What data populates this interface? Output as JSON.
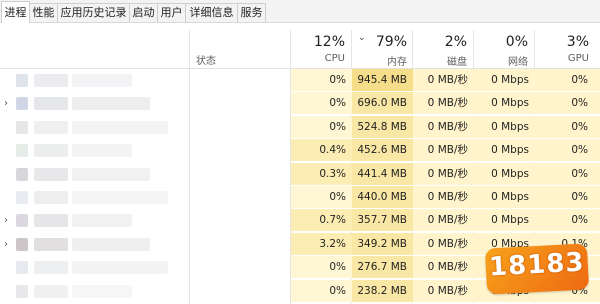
{
  "tabs": [
    "进程",
    "性能",
    "应用历史记录",
    "启动",
    "用户",
    "详细信息",
    "服务"
  ],
  "header": {
    "status_label": "状态",
    "columns": [
      {
        "pct": "12%",
        "label": "CPU"
      },
      {
        "pct": "79%",
        "label": "内存"
      },
      {
        "pct": "2%",
        "label": "磁盘"
      },
      {
        "pct": "0%",
        "label": "网络"
      },
      {
        "pct": "3%",
        "label": "GPU"
      }
    ],
    "sort_indicator": "⌄"
  },
  "rows": [
    {
      "cpu": "0%",
      "mem": "945.4 MB",
      "disk": "0 MB/秒",
      "net": "0 Mbps",
      "gpu": "0%",
      "expandable": false
    },
    {
      "cpu": "0%",
      "mem": "696.0 MB",
      "disk": "0 MB/秒",
      "net": "0 Mbps",
      "gpu": "0%",
      "expandable": true
    },
    {
      "cpu": "0%",
      "mem": "524.8 MB",
      "disk": "0 MB/秒",
      "net": "0 Mbps",
      "gpu": "0%",
      "expandable": false
    },
    {
      "cpu": "0.4%",
      "mem": "452.6 MB",
      "disk": "0 MB/秒",
      "net": "0 Mbps",
      "gpu": "0%",
      "expandable": false
    },
    {
      "cpu": "0.3%",
      "mem": "441.4 MB",
      "disk": "0 MB/秒",
      "net": "0 Mbps",
      "gpu": "0%",
      "expandable": false
    },
    {
      "cpu": "0%",
      "mem": "440.0 MB",
      "disk": "0 MB/秒",
      "net": "0 Mbps",
      "gpu": "0%",
      "expandable": false
    },
    {
      "cpu": "0.7%",
      "mem": "357.7 MB",
      "disk": "0 MB/秒",
      "net": "0 Mbps",
      "gpu": "0%",
      "expandable": true
    },
    {
      "cpu": "3.2%",
      "mem": "349.2 MB",
      "disk": "0 MB/秒",
      "net": "0 Mbps",
      "gpu": "0.1%",
      "expandable": true
    },
    {
      "cpu": "0%",
      "mem": "276.7 MB",
      "disk": "0 MB/秒",
      "net": "0 Mbps",
      "gpu": "0%",
      "expandable": false
    },
    {
      "cpu": "0%",
      "mem": "238.2 MB",
      "disk": "0 MB/秒",
      "net": "0 Mbps",
      "gpu": "0%",
      "expandable": false
    }
  ],
  "watermark": {
    "text": "18183"
  },
  "colors": {
    "cpu_light": "#fff6d4",
    "cpu_mid": "#fbedb4",
    "mem_strong": "#f6dd8a",
    "mem_mid": "#f9e7a6",
    "cell_light": "#fff4cc",
    "accent": "#f7a21b"
  }
}
